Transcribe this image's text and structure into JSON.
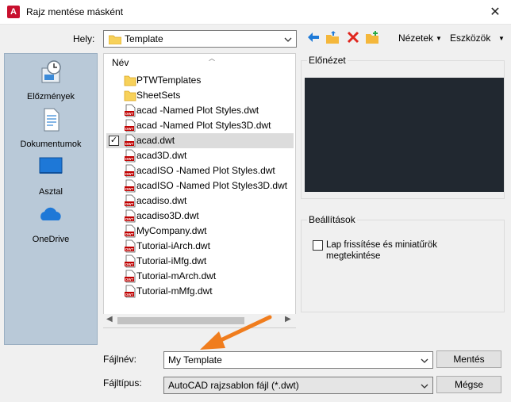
{
  "window": {
    "title": "Rajz mentése másként",
    "close_glyph": "✕",
    "app_icon_letter": "A"
  },
  "location": {
    "label": "Hely:",
    "value": "Template"
  },
  "toolbar": {
    "views_label": "Nézetek",
    "tools_label": "Eszközök"
  },
  "places": [
    {
      "label": "Előzmények",
      "icon": "history-icon"
    },
    {
      "label": "Dokumentumok",
      "icon": "documents-icon"
    },
    {
      "label": "Asztal",
      "icon": "desktop-icon"
    },
    {
      "label": "OneDrive",
      "icon": "onedrive-icon"
    }
  ],
  "files": {
    "column_header": "Név",
    "items": [
      {
        "name": "PTWTemplates",
        "type": "folder",
        "selected": false
      },
      {
        "name": "SheetSets",
        "type": "folder",
        "selected": false
      },
      {
        "name": "acad -Named Plot Styles.dwt",
        "type": "dwt",
        "selected": false
      },
      {
        "name": "acad -Named Plot Styles3D.dwt",
        "type": "dwt",
        "selected": false
      },
      {
        "name": "acad.dwt",
        "type": "dwt",
        "selected": true
      },
      {
        "name": "acad3D.dwt",
        "type": "dwt",
        "selected": false
      },
      {
        "name": "acadISO -Named Plot Styles.dwt",
        "type": "dwt",
        "selected": false
      },
      {
        "name": "acadISO -Named Plot Styles3D.dwt",
        "type": "dwt",
        "selected": false
      },
      {
        "name": "acadiso.dwt",
        "type": "dwt",
        "selected": false
      },
      {
        "name": "acadiso3D.dwt",
        "type": "dwt",
        "selected": false
      },
      {
        "name": "MyCompany.dwt",
        "type": "dwt",
        "selected": false
      },
      {
        "name": "Tutorial-iArch.dwt",
        "type": "dwt",
        "selected": false
      },
      {
        "name": "Tutorial-iMfg.dwt",
        "type": "dwt",
        "selected": false
      },
      {
        "name": "Tutorial-mArch.dwt",
        "type": "dwt",
        "selected": false
      },
      {
        "name": "Tutorial-mMfg.dwt",
        "type": "dwt",
        "selected": false
      }
    ]
  },
  "preview": {
    "title": "Előnézet"
  },
  "settings": {
    "title": "Beállítások",
    "checkbox_label": "Lap frissítése és miniatűrök megtekintése",
    "checked": false
  },
  "filename": {
    "label": "Fájlnév:",
    "value": "My Template"
  },
  "filetype": {
    "label": "Fájltípus:",
    "value": "AutoCAD rajzsablon fájl (*.dwt)"
  },
  "buttons": {
    "save": "Mentés",
    "cancel": "Mégse"
  },
  "colors": {
    "accent_arrow": "#f07d1e",
    "places_bg": "#b9c9d8",
    "preview_bg": "#212830",
    "file_icon_red": "#c00000",
    "folder_yellow": "#f7d15a"
  }
}
